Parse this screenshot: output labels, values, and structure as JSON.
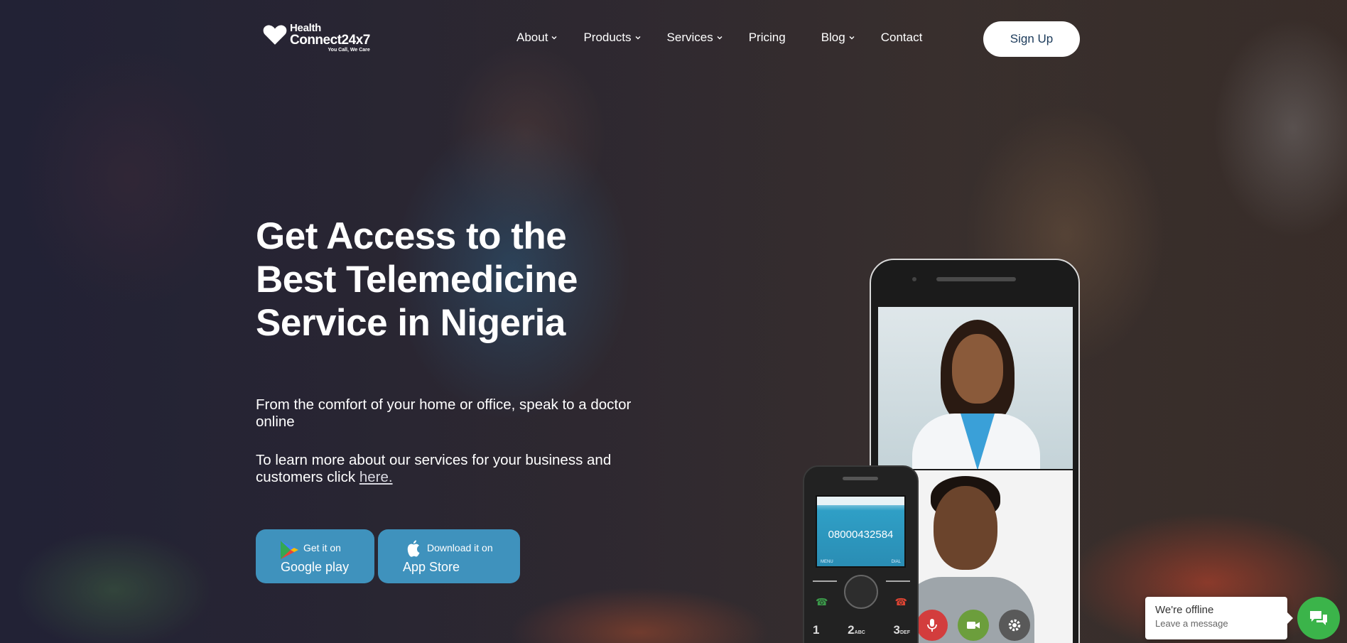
{
  "brand": {
    "line1": "Health",
    "line2": "Connect24x7",
    "tagline": "You Call, We Care"
  },
  "nav": {
    "items": [
      {
        "label": "About",
        "has_dropdown": true
      },
      {
        "label": "Products",
        "has_dropdown": true
      },
      {
        "label": "Services",
        "has_dropdown": true
      },
      {
        "label": "Pricing",
        "has_dropdown": false
      },
      {
        "label": "Blog",
        "has_dropdown": true
      },
      {
        "label": "Contact",
        "has_dropdown": false
      }
    ],
    "signup_label": "Sign Up"
  },
  "hero": {
    "title_line1": "Get Access to the",
    "title_line2": "Best Telemedicine",
    "title_line3": "Service in Nigeria",
    "subtitle": "From the comfort of your home or office, speak to a doctor online",
    "business_text": "To learn more about our services for your business and customers click",
    "business_link": "here."
  },
  "store_buttons": {
    "google_play": {
      "small": "Get it on",
      "big": "Google play"
    },
    "app_store": {
      "small": "Download it on",
      "big": "App Store"
    }
  },
  "feature_phone": {
    "number": "08000432584",
    "menu_label": "MENU",
    "dial_label": "DIAL",
    "keys": [
      "1",
      "2",
      "3"
    ],
    "key_letters": [
      "",
      "ABC",
      "DEF"
    ]
  },
  "chat": {
    "status": "We're offline",
    "prompt": "Leave a message"
  },
  "colors": {
    "accent_button": "#3f92bd",
    "signup_text": "#1b3a5a",
    "chat_green": "#3bb44a"
  }
}
